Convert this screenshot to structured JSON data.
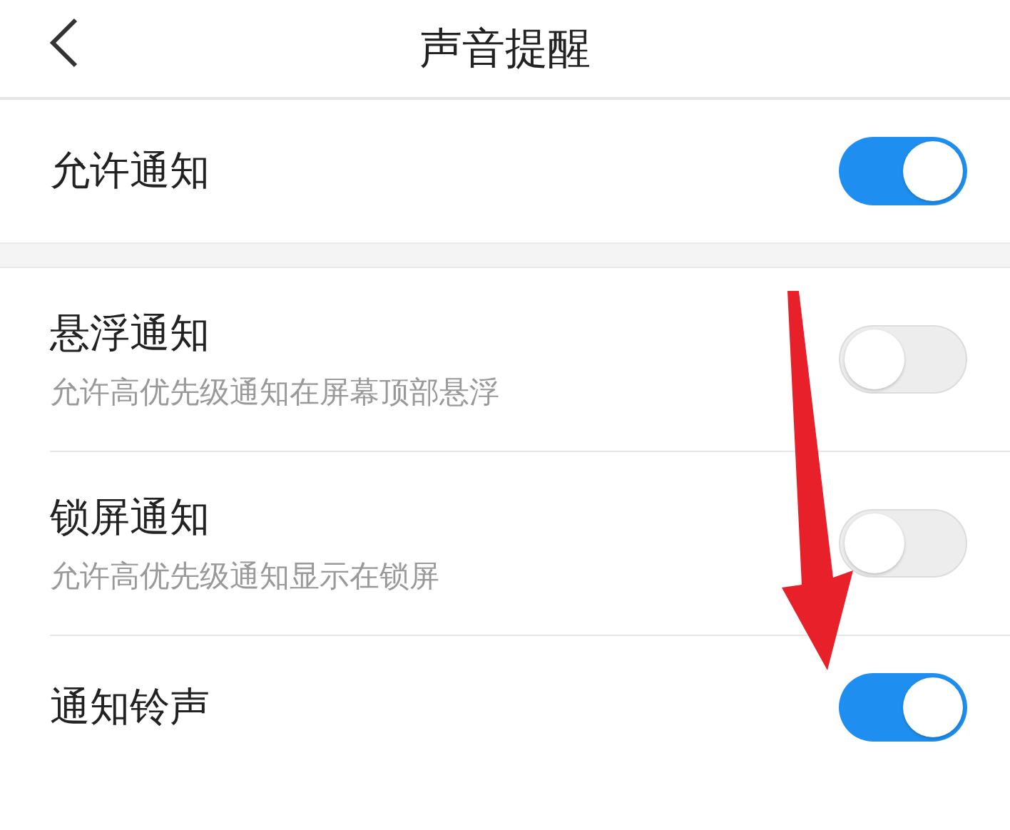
{
  "header": {
    "title": "声音提醒"
  },
  "sections": [
    {
      "items": [
        {
          "label": "允许通知",
          "on": true
        }
      ]
    },
    {
      "items": [
        {
          "label": "悬浮通知",
          "description": "允许高优先级通知在屏幕顶部悬浮",
          "on": false
        },
        {
          "label": "锁屏通知",
          "description": "允许高优先级通知显示在锁屏",
          "on": false
        },
        {
          "label": "通知铃声",
          "on": true
        }
      ]
    }
  ],
  "annotation": {
    "kind": "arrow"
  }
}
